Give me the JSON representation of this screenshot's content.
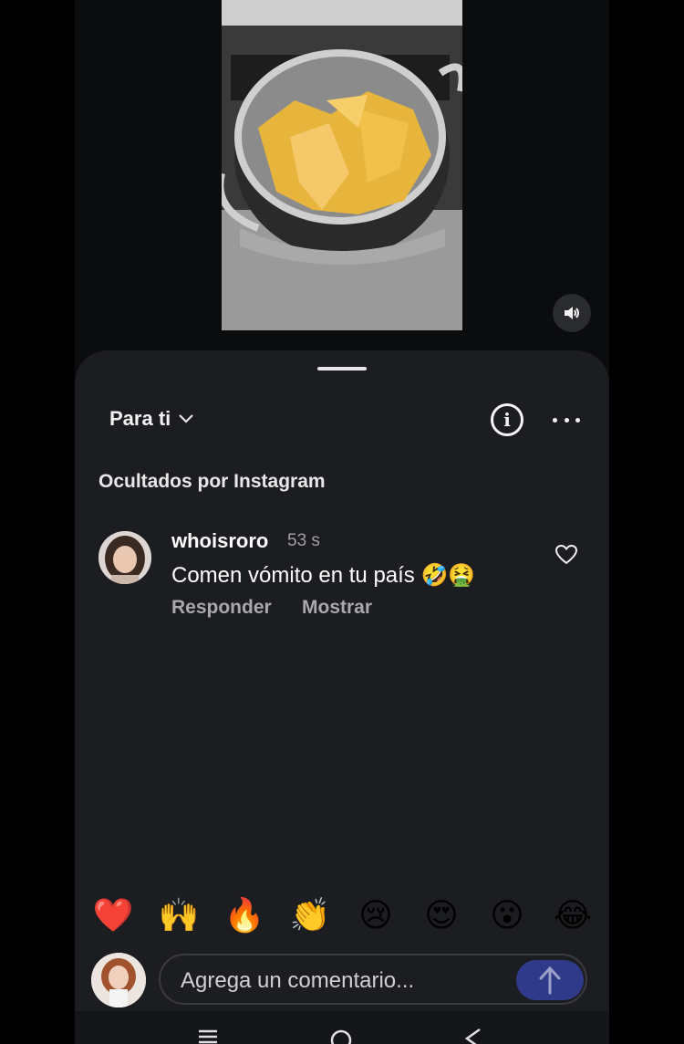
{
  "sheet": {
    "sort_label": "Para ti",
    "hidden_section_label": "Ocultados por Instagram"
  },
  "comment": {
    "username": "whoisroro",
    "time": "53 s",
    "text": "Comen vómito en tu país 🤣🤮",
    "reply_label": "Responder",
    "show_label": "Mostrar"
  },
  "reactions": [
    "❤️",
    "🙌",
    "🔥",
    "👏",
    "😢",
    "😍",
    "😮",
    "😂"
  ],
  "composer": {
    "placeholder": "Agrega un comentario..."
  },
  "icons": {
    "mute": "speaker-icon",
    "info": "info-icon",
    "more": "more-horizontal-icon",
    "like": "heart-outline-icon",
    "send": "arrow-up-icon",
    "sort": "chevron-down-icon"
  },
  "colors": {
    "sheet_bg": "#1c1d21",
    "send_button": "#2f3a8a",
    "secondary_text": "#a8a8ad"
  }
}
